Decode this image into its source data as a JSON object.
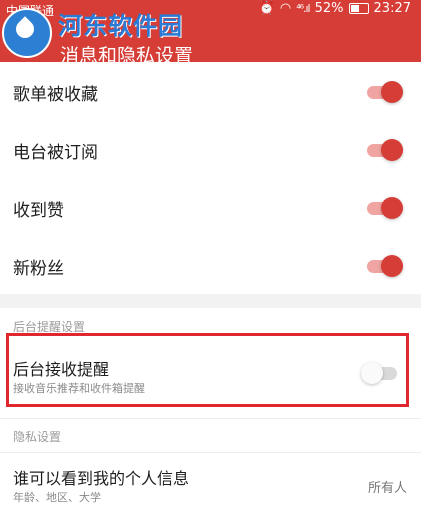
{
  "status_bar": {
    "carrier": "中国联通",
    "signal": "⁴⁶.ıl",
    "battery": "52%",
    "time": "23:27"
  },
  "watermark": {
    "text": "河东软件园"
  },
  "header": {
    "title": "消息和隐私设置",
    "color": "#d63d36"
  },
  "notify_items": [
    {
      "label": "歌单被收藏",
      "enabled": true
    },
    {
      "label": "电台被订阅",
      "enabled": true
    },
    {
      "label": "收到赞",
      "enabled": true
    },
    {
      "label": "新粉丝",
      "enabled": true
    }
  ],
  "background_section": {
    "title": "后台提醒设置",
    "item": {
      "label": "后台接收提醒",
      "subtitle": "接收音乐推荐和收件箱提醒",
      "enabled": false
    }
  },
  "privacy_section": {
    "title": "隐私设置",
    "item": {
      "label": "谁可以看到我的个人信息",
      "subtitle": "年龄、地区、大学",
      "value": "所有人"
    }
  }
}
